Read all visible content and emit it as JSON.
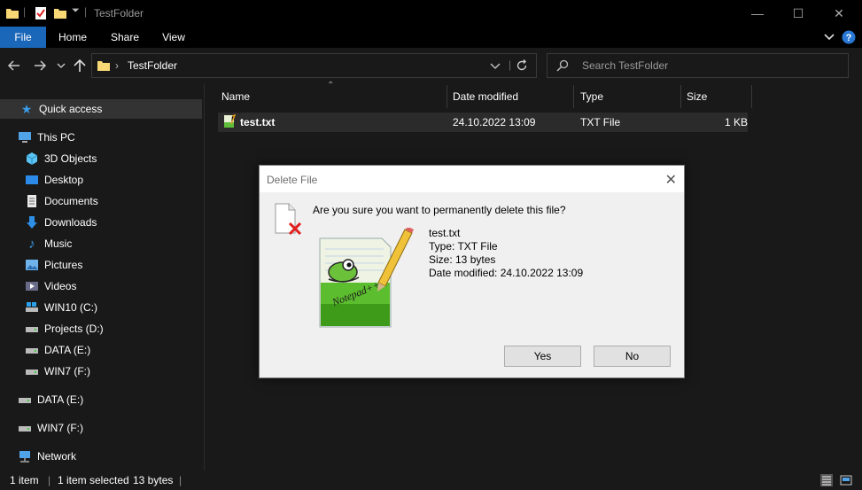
{
  "window": {
    "title": "TestFolder",
    "minimize_glyph": "—",
    "maximize_glyph": "☐",
    "close_glyph": "✕"
  },
  "ribbon": {
    "tabs": [
      "File",
      "Home",
      "Share",
      "View"
    ],
    "accent_color": "#1a66b8"
  },
  "address": {
    "path_separator": "›",
    "path": "TestFolder",
    "search_placeholder": "Search TestFolder"
  },
  "sidebar": {
    "quick_access": "Quick access",
    "this_pc": "This PC",
    "pc_items": [
      "3D Objects",
      "Desktop",
      "Documents",
      "Downloads",
      "Music",
      "Pictures",
      "Videos",
      "WIN10 (C:)",
      "Projects (D:)",
      "DATA (E:)",
      "WIN7 (F:)"
    ],
    "drives": [
      "DATA (E:)",
      "WIN7 (F:)"
    ],
    "network": "Network"
  },
  "columns": {
    "name": "Name",
    "date_modified": "Date modified",
    "type": "Type",
    "size": "Size"
  },
  "files": [
    {
      "name": "test.txt",
      "date_modified": "24.10.2022 13:09",
      "type": "TXT File",
      "size": "1 KB"
    }
  ],
  "status": {
    "count": "1 item",
    "selected": "1 item selected",
    "size": "13 bytes"
  },
  "dialog": {
    "title": "Delete File",
    "question": "Are you sure you want to permanently delete this file?",
    "file_name": "test.txt",
    "file_type": "Type: TXT File",
    "file_size": "Size: 13 bytes",
    "file_date": "Date modified: 24.10.2022 13:09",
    "yes_label": "Yes",
    "no_label": "No",
    "logo_text": "Notepad++"
  }
}
